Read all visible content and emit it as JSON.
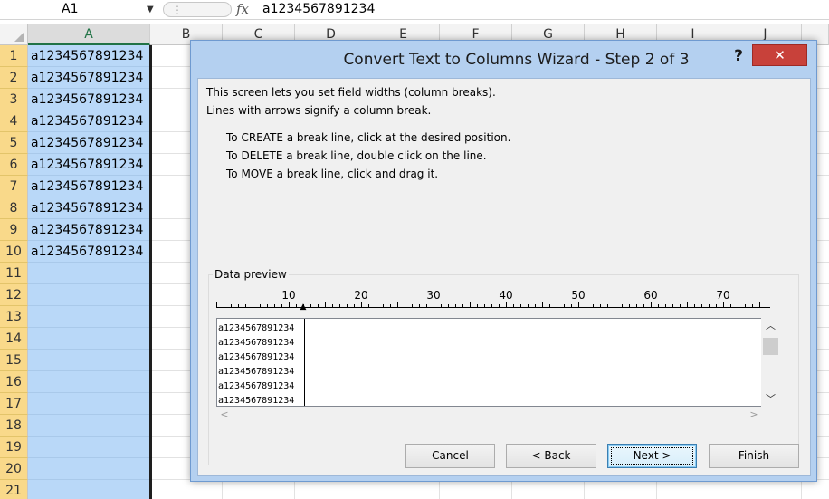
{
  "formula_bar": {
    "name_box": "A1",
    "fx_icon": "fx-icon",
    "formula": "a1234567891234"
  },
  "sheet": {
    "columns": [
      "A",
      "B",
      "C",
      "D",
      "E",
      "F",
      "G",
      "H",
      "I",
      "J"
    ],
    "rows": [
      "1",
      "2",
      "3",
      "4",
      "5",
      "6",
      "7",
      "8",
      "9",
      "10",
      "11",
      "12",
      "13",
      "14",
      "15",
      "16",
      "17",
      "18",
      "19",
      "20",
      "21"
    ],
    "cells_A": [
      "a1234567891234",
      "a1234567891234",
      "a1234567891234",
      "a1234567891234",
      "a1234567891234",
      "a1234567891234",
      "a1234567891234",
      "a1234567891234",
      "a1234567891234",
      "a1234567891234"
    ]
  },
  "dialog": {
    "title": "Convert Text to Columns Wizard - Step 2 of 3",
    "help_label": "?",
    "close_icon": "close-icon",
    "description": [
      "This screen lets you set field widths (column breaks).",
      "Lines with arrows signify a column break."
    ],
    "instructions": [
      "To CREATE a break line, click at the desired position.",
      "To DELETE a break line, double click on the line.",
      "To MOVE a break line, click and drag it."
    ],
    "preview_label": "Data preview",
    "ruler_numbers": [
      "10",
      "20",
      "30",
      "40",
      "50",
      "60",
      "70"
    ],
    "preview_lines": [
      "a1234567891234",
      "a1234567891234",
      "a1234567891234",
      "a1234567891234",
      "a1234567891234",
      "a1234567891234"
    ],
    "buttons": {
      "cancel": "Cancel",
      "back": "< Back",
      "next": "Next >",
      "finish": "Finish"
    }
  }
}
